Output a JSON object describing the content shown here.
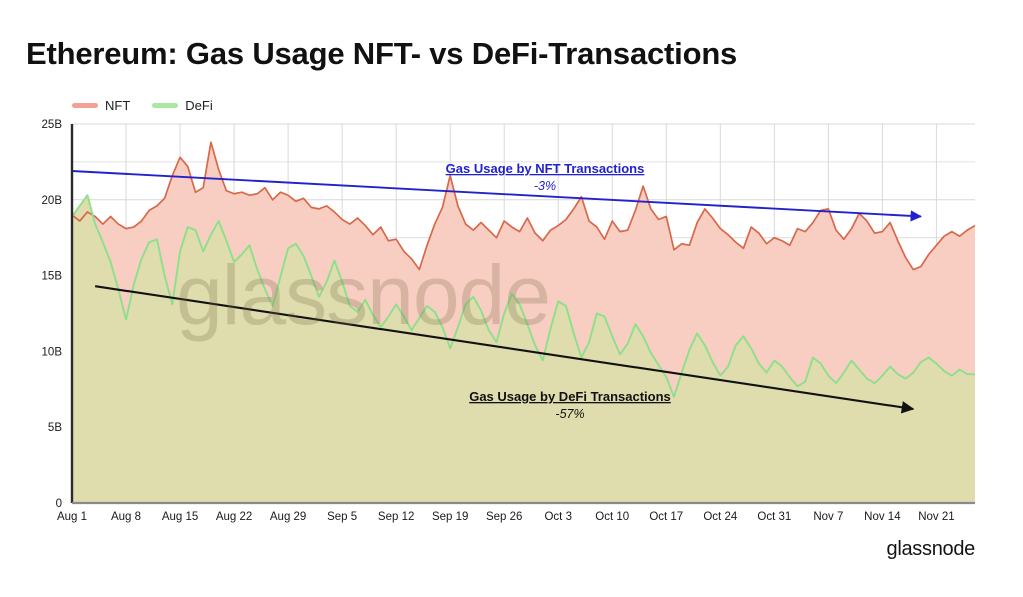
{
  "header": {
    "title": "Ethereum: Gas Usage NFT- vs DeFi-Transactions"
  },
  "legend": {
    "position": "top-left",
    "items": [
      {
        "label": "NFT",
        "color": "#f4a094"
      },
      {
        "label": "DeFi",
        "color": "#a8e8a0"
      }
    ]
  },
  "watermark": {
    "text": "glassnode"
  },
  "footer": {
    "logo": "glassnode"
  },
  "annotations": [
    {
      "id": "nft-trend",
      "title": "Gas Usage by NFT Transactions",
      "subtitle": "-3%",
      "color": "#2222cc"
    },
    {
      "id": "defi-trend",
      "title": "Gas Usage by DeFi Transactions",
      "subtitle": "-57%",
      "color": "#111111"
    }
  ],
  "chart_data": {
    "type": "area",
    "title": "Ethereum: Gas Usage NFT- vs DeFi-Transactions",
    "xlabel": "",
    "ylabel": "",
    "ylim": [
      0,
      25
    ],
    "yunit": "B",
    "ytick_labels": [
      "0",
      "5B",
      "10B",
      "15B",
      "20B",
      "25B"
    ],
    "ytick_values": [
      0,
      5,
      10,
      15,
      20,
      25
    ],
    "grid": true,
    "legend_position": "top-left",
    "x_tick_labels": [
      "Aug 1",
      "Aug 8",
      "Aug 15",
      "Aug 22",
      "Aug 29",
      "Sep 5",
      "Sep 12",
      "Sep 19",
      "Sep 26",
      "Oct 3",
      "Oct 10",
      "Oct 17",
      "Oct 24",
      "Oct 31",
      "Nov 7",
      "Nov 14",
      "Nov 21"
    ],
    "x_tick_indices": [
      0,
      7,
      14,
      21,
      28,
      35,
      42,
      49,
      56,
      63,
      70,
      77,
      84,
      91,
      98,
      105,
      112
    ],
    "x_count": 118,
    "series": [
      {
        "name": "NFT",
        "line_color": "#d9684a",
        "fill_color": "#f8cdc2",
        "values": [
          19.0,
          18.6,
          19.2,
          18.9,
          18.4,
          18.9,
          18.4,
          18.1,
          18.2,
          18.6,
          19.3,
          19.6,
          20.1,
          21.6,
          22.8,
          22.2,
          20.5,
          20.8,
          23.8,
          22.0,
          20.6,
          20.4,
          20.5,
          20.3,
          20.4,
          20.8,
          20.0,
          20.5,
          20.3,
          19.9,
          20.1,
          19.5,
          19.4,
          19.6,
          19.2,
          18.7,
          18.4,
          18.8,
          18.3,
          17.7,
          18.2,
          17.3,
          17.4,
          16.6,
          16.1,
          15.4,
          17.0,
          18.4,
          19.5,
          21.6,
          19.6,
          18.4,
          18.0,
          18.5,
          18.0,
          17.5,
          18.6,
          18.2,
          17.9,
          18.8,
          17.8,
          17.3,
          18.0,
          18.3,
          18.7,
          19.4,
          20.2,
          18.6,
          18.2,
          17.4,
          18.6,
          17.9,
          18.0,
          19.3,
          20.9,
          19.4,
          18.7,
          18.9,
          16.7,
          17.1,
          17.0,
          18.5,
          19.4,
          18.8,
          18.1,
          17.7,
          17.2,
          16.8,
          18.2,
          17.8,
          17.1,
          17.5,
          17.3,
          17.0,
          18.1,
          17.9,
          18.5,
          19.3,
          19.4,
          18.0,
          17.4,
          18.1,
          19.1,
          18.6,
          17.8,
          17.9,
          18.5,
          17.3,
          16.2,
          15.4,
          15.6,
          16.4,
          17.0,
          17.6,
          17.9,
          17.6,
          18.0,
          18.3
        ]
      },
      {
        "name": "DeFi",
        "line_color": "#8de08a",
        "fill_color": "#dfdcae",
        "values": [
          18.9,
          19.6,
          20.3,
          18.4,
          17.2,
          15.9,
          14.1,
          12.1,
          14.4,
          16.1,
          17.2,
          17.4,
          15.0,
          13.1,
          16.6,
          18.2,
          18.0,
          16.6,
          17.7,
          18.6,
          17.3,
          15.9,
          16.4,
          17.0,
          15.4,
          14.1,
          13.0,
          14.9,
          16.8,
          17.1,
          16.3,
          15.0,
          13.6,
          14.6,
          16.0,
          14.6,
          13.0,
          12.6,
          13.4,
          12.4,
          11.6,
          12.3,
          13.1,
          12.3,
          11.4,
          12.2,
          13.0,
          12.6,
          11.6,
          10.2,
          11.6,
          13.1,
          13.6,
          12.7,
          11.4,
          10.6,
          12.5,
          13.8,
          13.1,
          11.8,
          10.4,
          9.4,
          11.5,
          13.3,
          13.0,
          11.2,
          9.6,
          10.6,
          12.5,
          12.3,
          11.0,
          9.8,
          10.5,
          11.8,
          11.0,
          9.9,
          9.1,
          8.3,
          7.0,
          8.6,
          10.1,
          11.2,
          10.4,
          9.3,
          8.4,
          9.0,
          10.4,
          11.0,
          10.2,
          9.2,
          8.6,
          9.4,
          9.0,
          8.3,
          7.7,
          8.0,
          9.6,
          9.2,
          8.4,
          7.9,
          8.6,
          9.4,
          8.8,
          8.2,
          7.9,
          8.4,
          9.0,
          8.5,
          8.2,
          8.6,
          9.3,
          9.6,
          9.2,
          8.7,
          8.4,
          8.8,
          8.5,
          8.5
        ]
      }
    ],
    "trendlines": [
      {
        "name": "Gas Usage by NFT Transactions",
        "change": "-3%",
        "color": "#2222cc",
        "start": {
          "x_index": 0,
          "y": 21.9
        },
        "end": {
          "x_index": 110,
          "y": 18.9
        },
        "arrow": true
      },
      {
        "name": "Gas Usage by DeFi Transactions",
        "change": "-57%",
        "color": "#111111",
        "start": {
          "x_index": 3,
          "y": 14.3
        },
        "end": {
          "x_index": 109,
          "y": 6.2
        },
        "arrow": true
      }
    ]
  }
}
